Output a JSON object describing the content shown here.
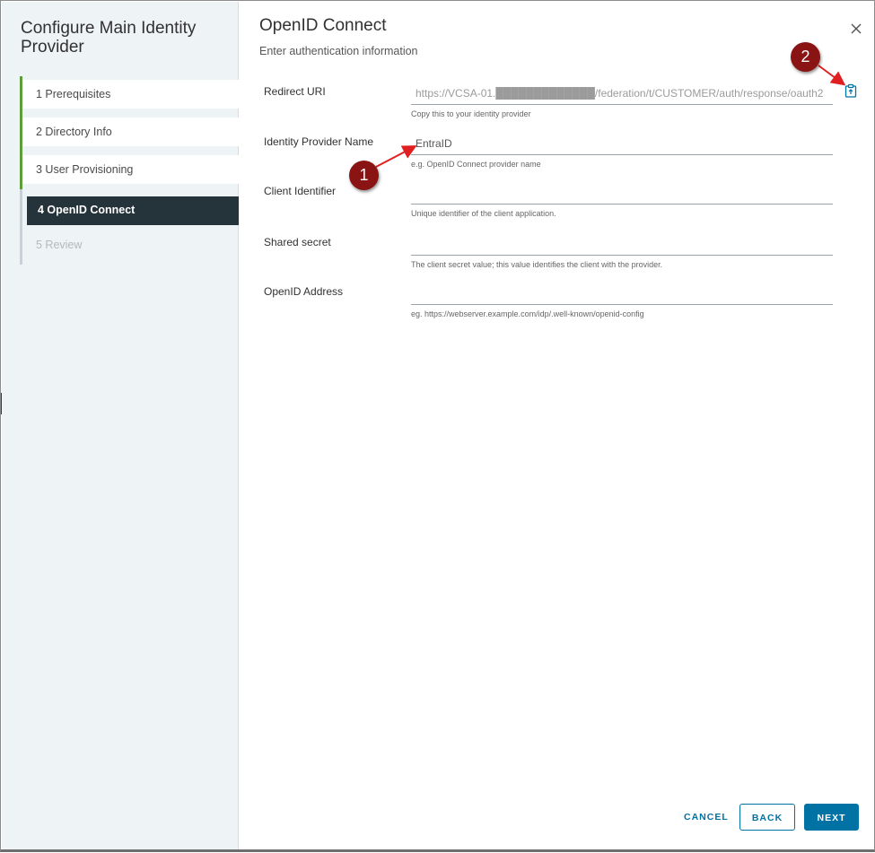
{
  "wizard": {
    "title": "Configure Main Identity Provider",
    "steps": [
      {
        "label": "1  Prerequisites",
        "state": "done"
      },
      {
        "label": "2  Directory Info",
        "state": "done"
      },
      {
        "label": "3  User Provisioning",
        "state": "done"
      },
      {
        "label": "4  OpenID Connect",
        "state": "current"
      },
      {
        "label": "5  Review",
        "state": "future"
      }
    ]
  },
  "page": {
    "title": "OpenID Connect",
    "subtitle": "Enter authentication information"
  },
  "form": {
    "redirect_uri": {
      "label": "Redirect URI",
      "value": "https://VCSA-01.█████████████/federation/t/CUSTOMER/auth/response/oauth2",
      "helper": "Copy this to your identity provider"
    },
    "idp_name": {
      "label": "Identity Provider Name",
      "value": "EntraID",
      "helper": "e.g. OpenID Connect provider name"
    },
    "client_id": {
      "label": "Client Identifier",
      "value": "",
      "helper": "Unique identifier of the client application."
    },
    "shared_secret": {
      "label": "Shared secret",
      "value": "",
      "helper": "The client secret value; this value identifies the client with the provider."
    },
    "openid_address": {
      "label": "OpenID Address",
      "value": "",
      "helper": "eg. https://webserver.example.com/idp/.well-known/openid-config"
    }
  },
  "annotations": {
    "marker_1": "1",
    "marker_2": "2"
  },
  "buttons": {
    "cancel": "CANCEL",
    "back": "BACK",
    "next": "NEXT"
  },
  "icons": {
    "close": "close-icon",
    "copy": "copy-clipboard-icon"
  },
  "colors": {
    "accent": "#0072a3",
    "step_done": "#5e9e3a",
    "step_current_bg": "#25333b",
    "marker": "#8a1313",
    "arrow": "#e02020"
  }
}
